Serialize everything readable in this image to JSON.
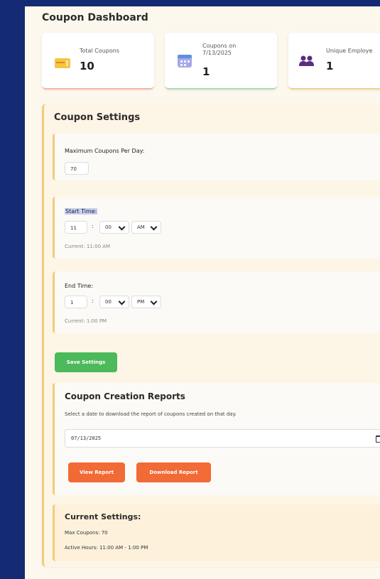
{
  "dashboard": {
    "title": "Coupon Dashboard"
  },
  "stats": [
    {
      "label": "Total Coupons",
      "value": "10"
    },
    {
      "label": "Coupons on 7/13/2025",
      "value": "1"
    },
    {
      "label": "Unique Employe",
      "value": "1"
    }
  ],
  "settings": {
    "title": "Coupon Settings",
    "max_per_day": {
      "label": "Maximum Coupons Per Day:",
      "value": "70"
    },
    "start_time": {
      "label": "Start Time:",
      "hour": "11",
      "minute": "00",
      "ampm": "AM",
      "current": "Current: 11:00 AM"
    },
    "end_time": {
      "label": "End Time:",
      "hour": "1",
      "minute": "00",
      "ampm": "PM",
      "current": "Current: 1:00 PM"
    },
    "colon": ":",
    "save_label": "Save Settings"
  },
  "reports": {
    "title": "Coupon Creation Reports",
    "description": "Select a date to download the report of coupons created on that day.",
    "date_value": "07/13/2025",
    "view_label": "View Report",
    "download_label": "Download Report"
  },
  "current_settings": {
    "title": "Current Settings:",
    "max_coupons": "Max Coupons: 70",
    "active_hours": "Active Hours: 11:00 AM - 1:00 PM"
  },
  "colors": {
    "background": "#142a72",
    "accent_yellow": "#f3cc7a",
    "save_green": "#4cb95a",
    "report_orange": "#f26a35"
  },
  "icons": [
    "ticket-icon",
    "calendar-icon",
    "users-icon",
    "chevron-down-icon",
    "calendar-picker-icon"
  ]
}
